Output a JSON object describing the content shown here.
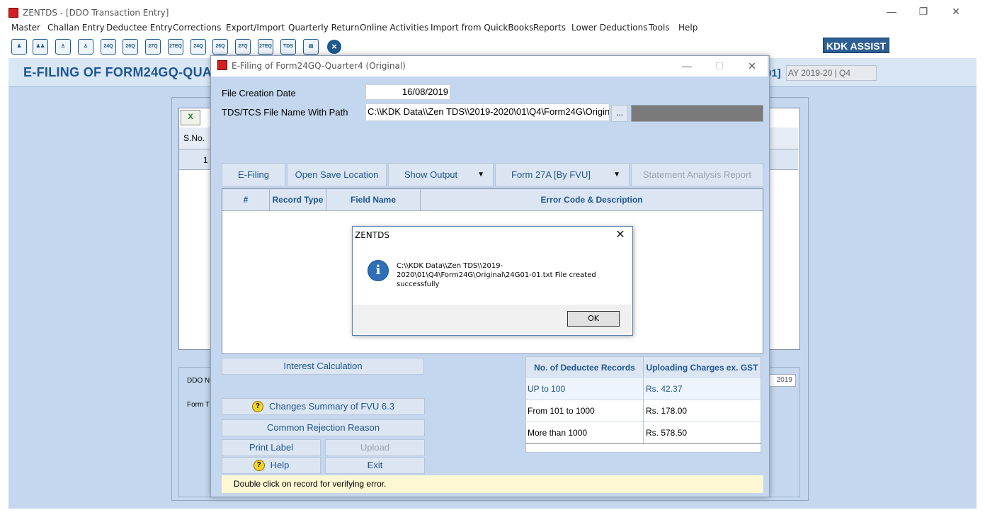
{
  "window": {
    "title": "ZENTDS - [DDO Transaction Entry]",
    "controls": {
      "minimize": "—",
      "restore": "❐",
      "close": "✕"
    }
  },
  "menu": [
    "Master",
    "Challan Entry",
    "Deductee Entry",
    "Corrections",
    "Export/Import",
    "Quarterly Return",
    "Online Activities",
    "Import from QuickBooks",
    "Reports",
    "Lower Deductions",
    "Tools",
    "Help"
  ],
  "toolbar": {
    "icons": [
      "users-icon",
      "group-icon",
      "person-icon",
      "person-add-icon",
      "form-24q-doc-icon",
      "form-26q-doc-icon",
      "form-27q-doc-icon",
      "form-27eq-doc-icon",
      "e-24q-icon",
      "e-26q-icon",
      "e-27q-icon",
      "e-27eq-icon",
      "tds-icon",
      "notepad-icon",
      "close-circle-icon"
    ],
    "labels": [
      "24Q",
      "26Q",
      "27Q",
      "27EQ",
      "TDS"
    ],
    "kdk_assist": "KDK ASSIST"
  },
  "page": {
    "heading": "E-FILING OF FORM24GQ-QUA",
    "heading_suffix": "01]",
    "ay": "AY 2019-20 | Q4",
    "grid_sno_header": "S.No.",
    "grid_row1_num": "1",
    "ddo_label": "DDO N",
    "form_label": "Form T",
    "right_year": "2019"
  },
  "dialog": {
    "title": "E-Filing of Form24GQ-Quarter4 (Original)",
    "file_creation_date_label": "File Creation Date",
    "file_creation_date": "16/08/2019",
    "path_label": "TDS/TCS File Name With Path",
    "path_value": "C:\\\\KDK Data\\\\Zen TDS\\\\2019-2020\\01\\Q4\\Form24G\\Original",
    "browse": "...",
    "tabs": {
      "efiling": "E-Filing",
      "open_save_location": "Open Save Location",
      "show_output": "Show Output",
      "form27a": "Form 27A [By FVU]",
      "statement_analysis": "Statement Analysis Report"
    },
    "dropdown_arrow": "▼",
    "error_columns": [
      "#",
      "Record Type",
      "Field Name",
      "Error Code & Description"
    ],
    "buttons": {
      "interest_calculation": "Interest Calculation",
      "changes_summary": "Changes Summary of FVU 6.3",
      "common_rejection": "Common Rejection Reason",
      "print_label": "Print Label",
      "upload": "Upload",
      "help": "Help",
      "exit": "Exit"
    },
    "help_glyph": "?",
    "charges": {
      "headers": [
        "No. of Deductee Records",
        "Uploading Charges ex. GST"
      ],
      "rows": [
        {
          "range": "UP to 100",
          "charge": "Rs. 42.37"
        },
        {
          "range": "From 101 to 1000",
          "charge": "Rs. 178.00"
        },
        {
          "range": "More than 1000",
          "charge": "Rs. 578.50"
        }
      ]
    },
    "hint": "Double click on record for verifying error."
  },
  "message_box": {
    "title": "ZENTDS",
    "icon": "info-icon",
    "icon_glyph": "i",
    "text": "C:\\\\KDK Data\\\\Zen TDS\\\\2019-2020\\01\\Q4\\Form24G\\Original\\24G01-01.txt File created successfully",
    "ok": "OK",
    "close": "✕"
  },
  "colors": {
    "client_bg": "#c4d7ee",
    "accent_text": "#1d5592",
    "kdk_assist_bg": "#2d5f94",
    "hint_bg": "#fdf7d4"
  }
}
